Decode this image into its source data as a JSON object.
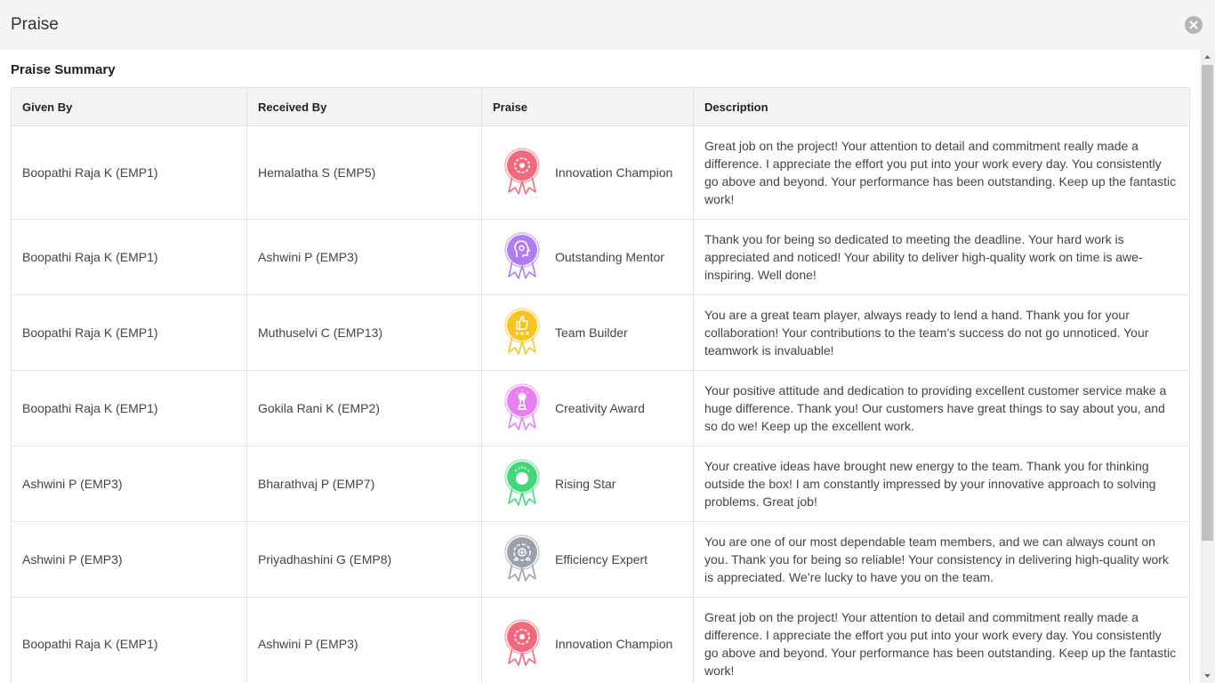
{
  "header": {
    "title": "Praise"
  },
  "summary": {
    "title": "Praise Summary",
    "columns": [
      "Given By",
      "Received By",
      "Praise",
      "Description"
    ],
    "rows": [
      {
        "given_by": "Boopathi Raja K (EMP1)",
        "received_by": "Hemalatha S (EMP5)",
        "praise": "Innovation Champion",
        "icon": "innovation-gear-icon",
        "color": "#f5677a",
        "description": "Great job on the project! Your attention to detail and commitment really made a difference. I appreciate the effort you put into your work every day. You consistently go above and beyond. Your performance has been outstanding. Keep up the fantastic work!"
      },
      {
        "given_by": "Boopathi Raja K (EMP1)",
        "received_by": "Ashwini P (EMP3)",
        "praise": "Outstanding Mentor",
        "icon": "mentor-head-icon",
        "color": "#b07cf2",
        "description": "Thank you for being so dedicated to meeting the deadline. Your hard work is appreciated and noticed! Your ability to deliver high-quality work on time is awe-inspiring. Well done!"
      },
      {
        "given_by": "Boopathi Raja K (EMP1)",
        "received_by": "Muthuselvi C (EMP13)",
        "praise": "Team Builder",
        "icon": "thumbs-up-team-icon",
        "color": "#f7c51e",
        "description": "You are a great team player, always ready to lend a hand. Thank you for your collaboration! Your contributions to the team’s success do not go unnoticed. Your teamwork is invaluable!"
      },
      {
        "given_by": "Boopathi Raja K (EMP1)",
        "received_by": "Gokila Rani K (EMP2)",
        "praise": "Creativity Award",
        "icon": "lightbulb-trophy-icon",
        "color": "#e77ff0",
        "description": "Your positive attitude and dedication to providing excellent customer service make a huge difference. Thank you! Our customers have great things to say about you, and so do we! Keep up the excellent work."
      },
      {
        "given_by": "Ashwini P (EMP3)",
        "received_by": "Bharathvaj P (EMP7)",
        "praise": "Rising Star",
        "icon": "rising-star-icon",
        "color": "#45d67c",
        "description": "Your creative ideas have brought new energy to the team. Thank you for thinking outside the box! I am constantly impressed by your innovative approach to solving problems. Great job!"
      },
      {
        "given_by": "Ashwini P (EMP3)",
        "received_by": "Priyadhashini G (EMP8)",
        "praise": "Efficiency Expert",
        "icon": "efficiency-gears-icon",
        "color": "#9aa1ad",
        "description": "You are one of our most dependable team members, and we can always count on you. Thank you for being so reliable! Your consistency in delivering high-quality work is appreciated. We’re lucky to have you on the team."
      },
      {
        "given_by": "Boopathi Raja K (EMP1)",
        "received_by": "Ashwini P (EMP3)",
        "praise": "Innovation Champion",
        "icon": "innovation-gear-icon",
        "color": "#f5677a",
        "description": "Great job on the project! Your attention to detail and commitment really made a difference. I appreciate the effort you put into your work every day. You consistently go above and beyond. Your performance has been outstanding. Keep up the fantastic work!"
      }
    ]
  },
  "icons": {
    "close": "close-circle-icon",
    "scroll_up": "chevron-up-icon",
    "scroll_down": "chevron-down-icon"
  }
}
